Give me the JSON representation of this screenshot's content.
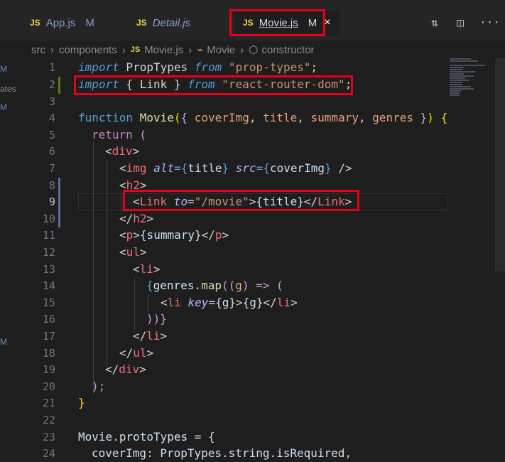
{
  "tabs": [
    {
      "icon": "JS",
      "name": "App.js",
      "status": "M"
    },
    {
      "icon": "JS",
      "name": "Detail.js",
      "status": ""
    },
    {
      "icon": "JS",
      "name": "Movie.js",
      "status": "M",
      "close": "×"
    }
  ],
  "breadcrumb": [
    "src",
    "components",
    "Movie.js",
    "Movie",
    "constructor"
  ],
  "breadcrumb_js": "JS",
  "left_strip": [
    "M",
    "ates",
    "M",
    "M"
  ],
  "line_numbers": [
    "1",
    "2",
    "3",
    "4",
    "5",
    "6",
    "7",
    "8",
    "9",
    "10",
    "11",
    "12",
    "13",
    "14",
    "15",
    "16",
    "17",
    "18",
    "19",
    "20",
    "21",
    "22",
    "23",
    "24"
  ],
  "code": {
    "l1": {
      "a": "import",
      "b": " PropTypes ",
      "c": "from",
      "d": " \"prop-types\"",
      "e": ";"
    },
    "l2": {
      "a": "import",
      "b": " { Link } ",
      "c": "from",
      "d": " \"react-router-dom\"",
      "e": ";"
    },
    "l4": {
      "a": "function",
      "b": " Movie",
      "c": "(",
      "d": "{ ",
      "e": "coverImg",
      ",1": ", ",
      "f": "title",
      "g": ", ",
      "h": "summary",
      "i": ", ",
      "j": "genres",
      "k": " }",
      "l": ")",
      "m": " {"
    },
    "l5": {
      "a": "return",
      "b": " ("
    },
    "l6": {
      "a": "<",
      "b": "div",
      "c": ">"
    },
    "l7": {
      "a": "<",
      "b": "img",
      "c": " alt",
      "d": "={",
      "e": "title",
      "f": "}",
      "g": " src",
      "h": "={",
      "i": "coverImg",
      "j": "}",
      "k": " />"
    },
    "l8": {
      "a": "<",
      "b": "h2",
      "c": ">"
    },
    "l9": {
      "a": "<",
      "b": "Link",
      "c": " to",
      "d": "=",
      "e": "\"/movie\"",
      "f": ">",
      "g": "{title}",
      "h": "</",
      "i": "Link",
      "j": ">"
    },
    "l10": {
      "a": "</",
      "b": "h2",
      "c": ">"
    },
    "l11": {
      "a": "<",
      "b": "p",
      "c": ">",
      "d": "{summary}",
      "e": "</",
      "f": "p",
      "g": ">"
    },
    "l12": {
      "a": "<",
      "b": "ul",
      "c": ">"
    },
    "l13": {
      "a": "<",
      "b": "li",
      "c": ">"
    },
    "l14": {
      "a": "{",
      "b": "genres",
      "c": ".",
      "d": "map",
      "e": "((",
      "f": "g",
      "g": ") => ("
    },
    "l15": {
      "a": "<",
      "b": "li",
      "c": " key",
      "d": "=",
      "e": "{g}",
      "f": ">",
      "g": "{g}",
      "h": "</",
      "i": "li",
      "j": ">"
    },
    "l16": {
      "a": "))}"
    },
    "l17": {
      "a": "</",
      "b": "li",
      "c": ">"
    },
    "l18": {
      "a": "</",
      "b": "ul",
      "c": ">"
    },
    "l19": {
      "a": "</",
      "b": "div",
      "c": ">"
    },
    "l20": {
      "a": ");"
    },
    "l21": {
      "a": "}"
    },
    "l23": {
      "a": "Movie",
      "b": ".",
      "c": "protoTypes",
      "d": " = {"
    },
    "l24": {
      "a": "coverImg",
      "b": ": ",
      "c": "PropTypes",
      "d": ".",
      "e": "string",
      "f": ".",
      "g": "isRequired",
      "h": ","
    }
  },
  "colors": {
    "highlight": "#e5001c",
    "background": "#1e1e1e"
  }
}
